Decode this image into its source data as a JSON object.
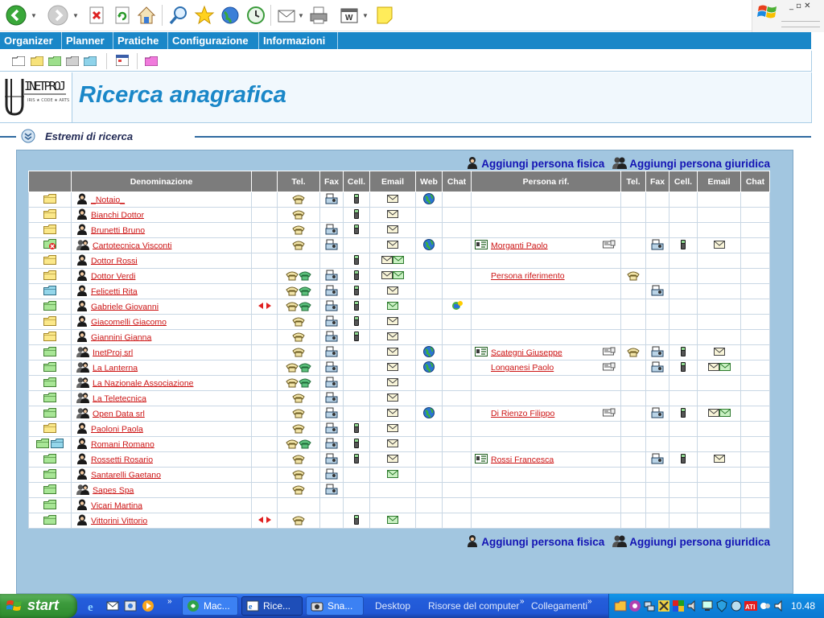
{
  "app": {
    "menu": [
      "Organizer",
      "Planner",
      "Pratiche",
      "Configurazione",
      "Informazioni"
    ],
    "page_title": "Ricerca anagrafica",
    "section_title": "Estremi di ricerca",
    "add_physical": "Aggiungi persona fisica",
    "add_legal": "Aggiungi persona giuridica",
    "logo_text": "INETPROJ"
  },
  "table": {
    "headers": [
      "",
      "Denominazione",
      "",
      "Tel.",
      "Fax",
      "Cell.",
      "Email",
      "Web",
      "Chat",
      "Persona rif.",
      "Tel.",
      "Fax",
      "Cell.",
      "Email",
      "Chat"
    ],
    "rows": [
      {
        "folder": "yellow",
        "type": "person",
        "name": "_Notaio_",
        "tel": "1",
        "fax": true,
        "cell": true,
        "email": "1",
        "web": true,
        "chat": false,
        "ref": "",
        "rtel": false,
        "rfax": false,
        "rcell": false,
        "remail": "0",
        "arrows": false
      },
      {
        "folder": "yellow",
        "type": "person",
        "name": "Bianchi Dottor",
        "tel": "1",
        "fax": false,
        "cell": true,
        "email": "1",
        "web": false,
        "chat": false,
        "ref": "",
        "rtel": false,
        "rfax": false,
        "rcell": false,
        "remail": "0",
        "arrows": false
      },
      {
        "folder": "yellow",
        "type": "person",
        "name": "Brunetti Bruno",
        "tel": "1",
        "fax": true,
        "cell": true,
        "email": "1",
        "web": false,
        "chat": false,
        "ref": "",
        "rtel": false,
        "rfax": false,
        "rcell": false,
        "remail": "0",
        "arrows": false
      },
      {
        "folder": "green-x",
        "type": "company",
        "name": "Cartotecnica Visconti",
        "tel": "1",
        "fax": true,
        "cell": false,
        "email": "1",
        "web": true,
        "chat": false,
        "ref": "Morganti Paolo",
        "refcard": true,
        "refphone": true,
        "rtel": false,
        "rfax": true,
        "rcell": true,
        "remail": "1",
        "arrows": false
      },
      {
        "folder": "yellow",
        "type": "person",
        "name": "Dottor Rossi",
        "tel": "0",
        "fax": false,
        "cell": true,
        "email": "2",
        "web": false,
        "chat": false,
        "ref": "",
        "rtel": false,
        "rfax": false,
        "rcell": false,
        "remail": "0",
        "arrows": false
      },
      {
        "folder": "yellow",
        "type": "person",
        "name": "Dottor Verdi",
        "tel": "2",
        "fax": true,
        "cell": true,
        "email": "2",
        "web": false,
        "chat": false,
        "ref": "Persona riferimento",
        "refcard": false,
        "refphone": false,
        "rtel": true,
        "rfax": false,
        "rcell": false,
        "remail": "0",
        "arrows": false
      },
      {
        "folder": "teal",
        "type": "person",
        "name": "Felicetti Rita",
        "tel": "2",
        "fax": true,
        "cell": true,
        "email": "1",
        "web": false,
        "chat": false,
        "ref": "",
        "rtel": false,
        "rfax": true,
        "rcell": false,
        "remail": "0",
        "arrows": false
      },
      {
        "folder": "green",
        "type": "person",
        "name": "Gabriele Giovanni",
        "tel": "2",
        "fax": true,
        "cell": true,
        "email": "g",
        "web": false,
        "chat": true,
        "ref": "",
        "rtel": false,
        "rfax": false,
        "rcell": false,
        "remail": "0",
        "arrows": true
      },
      {
        "folder": "yellow",
        "type": "person",
        "name": "Giacomelli Giacomo",
        "tel": "1",
        "fax": true,
        "cell": true,
        "email": "1",
        "web": false,
        "chat": false,
        "ref": "",
        "rtel": false,
        "rfax": false,
        "rcell": false,
        "remail": "0",
        "arrows": false
      },
      {
        "folder": "yellow",
        "type": "person",
        "name": "Giannini Gianna",
        "tel": "1",
        "fax": true,
        "cell": true,
        "email": "1",
        "web": false,
        "chat": false,
        "ref": "",
        "rtel": false,
        "rfax": false,
        "rcell": false,
        "remail": "0",
        "arrows": false
      },
      {
        "folder": "green",
        "type": "company",
        "name": "InetProj srl",
        "tel": "1",
        "fax": true,
        "cell": false,
        "email": "1",
        "web": true,
        "chat": false,
        "ref": "Scategni Giuseppe",
        "refcard": true,
        "refphone": true,
        "rtel": true,
        "rfax": true,
        "rcell": true,
        "remail": "1",
        "arrows": false
      },
      {
        "folder": "green",
        "type": "company",
        "name": "La Lanterna",
        "tel": "2",
        "fax": true,
        "cell": false,
        "email": "1",
        "web": true,
        "chat": false,
        "ref": "Longanesi Paolo",
        "refcard": false,
        "refphone": true,
        "rtel": false,
        "rfax": true,
        "rcell": true,
        "remail": "2",
        "arrows": false
      },
      {
        "folder": "green",
        "type": "company",
        "name": "La Nazionale Associazione",
        "tel": "2",
        "fax": true,
        "cell": false,
        "email": "1",
        "web": false,
        "chat": false,
        "ref": "",
        "rtel": false,
        "rfax": false,
        "rcell": false,
        "remail": "0",
        "arrows": false
      },
      {
        "folder": "green",
        "type": "company",
        "name": "La Teletecnica",
        "tel": "1",
        "fax": true,
        "cell": false,
        "email": "1",
        "web": false,
        "chat": false,
        "ref": "",
        "rtel": false,
        "rfax": false,
        "rcell": false,
        "remail": "0",
        "arrows": false
      },
      {
        "folder": "green",
        "type": "company",
        "name": "Open Data srl",
        "tel": "1",
        "fax": true,
        "cell": false,
        "email": "1",
        "web": true,
        "chat": false,
        "ref": "Di Rienzo Filippo",
        "refcard": false,
        "refphone": true,
        "rtel": false,
        "rfax": true,
        "rcell": true,
        "remail": "2",
        "arrows": false
      },
      {
        "folder": "yellow",
        "type": "person",
        "name": "Paoloni Paola",
        "tel": "1",
        "fax": true,
        "cell": true,
        "email": "1",
        "web": false,
        "chat": false,
        "ref": "",
        "rtel": false,
        "rfax": false,
        "rcell": false,
        "remail": "0",
        "arrows": false
      },
      {
        "folder": "double",
        "type": "person",
        "name": "Romani Romano",
        "tel": "2",
        "fax": true,
        "cell": true,
        "email": "1",
        "web": false,
        "chat": false,
        "ref": "",
        "rtel": false,
        "rfax": false,
        "rcell": false,
        "remail": "0",
        "arrows": false
      },
      {
        "folder": "green",
        "type": "person",
        "name": "Rossetti Rosario",
        "tel": "1",
        "fax": true,
        "cell": true,
        "email": "1",
        "web": false,
        "chat": false,
        "ref": "Rossi Francesca",
        "refcard": true,
        "refphone": false,
        "rtel": false,
        "rfax": true,
        "rcell": true,
        "remail": "1",
        "arrows": false
      },
      {
        "folder": "green",
        "type": "person",
        "name": "Santarelli Gaetano",
        "tel": "1",
        "fax": true,
        "cell": false,
        "email": "g",
        "web": false,
        "chat": false,
        "ref": "",
        "rtel": false,
        "rfax": false,
        "rcell": false,
        "remail": "0",
        "arrows": false
      },
      {
        "folder": "green",
        "type": "company",
        "name": "Sapes Spa",
        "tel": "1",
        "fax": true,
        "cell": false,
        "email": "0",
        "web": false,
        "chat": false,
        "ref": "",
        "rtel": false,
        "rfax": false,
        "rcell": false,
        "remail": "0",
        "arrows": false
      },
      {
        "folder": "green",
        "type": "person",
        "name": "Vicari Martina",
        "tel": "0",
        "fax": false,
        "cell": false,
        "email": "0",
        "web": false,
        "chat": false,
        "ref": "",
        "rtel": false,
        "rfax": false,
        "rcell": false,
        "remail": "0",
        "arrows": false
      },
      {
        "folder": "green",
        "type": "person",
        "name": "Vittorini Vittorio",
        "tel": "1",
        "fax": false,
        "cell": true,
        "email": "g",
        "web": false,
        "chat": false,
        "ref": "",
        "rtel": false,
        "rfax": false,
        "rcell": false,
        "remail": "0",
        "arrows": true
      }
    ]
  },
  "taskbar": {
    "start": "start",
    "tasks": [
      "Mac...",
      "Rice...",
      "Sna..."
    ],
    "links": [
      "Desktop",
      "Risorse del computer",
      "Collegamenti"
    ],
    "clock": "10.48"
  },
  "colors": {
    "accent": "#1a87c8",
    "panel": "#a2c6e0",
    "link": "#cc1414",
    "add_link": "#1414b4"
  }
}
